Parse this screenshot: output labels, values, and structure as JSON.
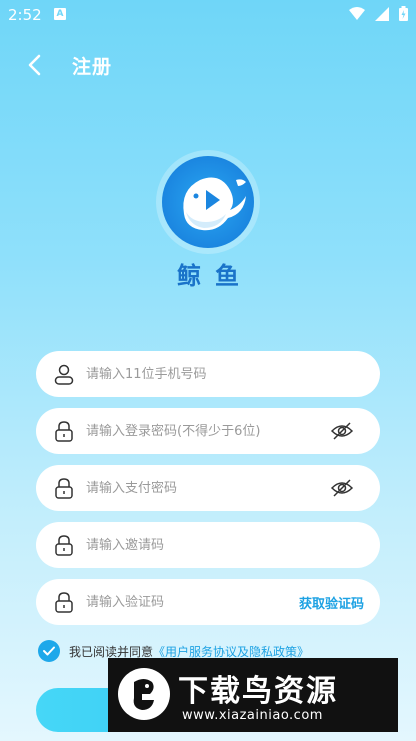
{
  "status_bar": {
    "time": "2:52",
    "app_icon_letter": "A",
    "icons": [
      "wifi-icon",
      "signal-icon",
      "battery-icon"
    ]
  },
  "header": {
    "title": "注册",
    "back_icon": "chevron-left-icon"
  },
  "logo": {
    "name": "鲸鱼",
    "icon": "whale-logo"
  },
  "form": {
    "phone": {
      "placeholder": "请输入11位手机号码",
      "value": "",
      "icon": "user-icon"
    },
    "login_password": {
      "placeholder": "请输入登录密码(不得少于6位)",
      "value": "",
      "icon": "lock-icon",
      "toggle_icon": "eye-off-icon"
    },
    "pay_password": {
      "placeholder": "请输入支付密码",
      "value": "",
      "icon": "lock-icon",
      "toggle_icon": "eye-off-icon"
    },
    "invite_code": {
      "placeholder": "请输入邀请码",
      "value": "",
      "icon": "lock-icon"
    },
    "verify_code": {
      "placeholder": "请输入验证码",
      "value": "",
      "icon": "lock-icon",
      "get_code_label": "获取验证码"
    }
  },
  "agreement": {
    "checked": true,
    "text": "我已阅读并同意",
    "link": "《用户服务协议及隐私政策》"
  },
  "register_button": {
    "label": ""
  },
  "watermark": {
    "title": "下载鸟资源",
    "url": "www.xiazainiao.com"
  },
  "colors": {
    "accent": "#1ea2e3",
    "logo_text": "#1a73c9",
    "background_top": "#6fd6f8",
    "background_bottom": "#e4f7fe"
  }
}
